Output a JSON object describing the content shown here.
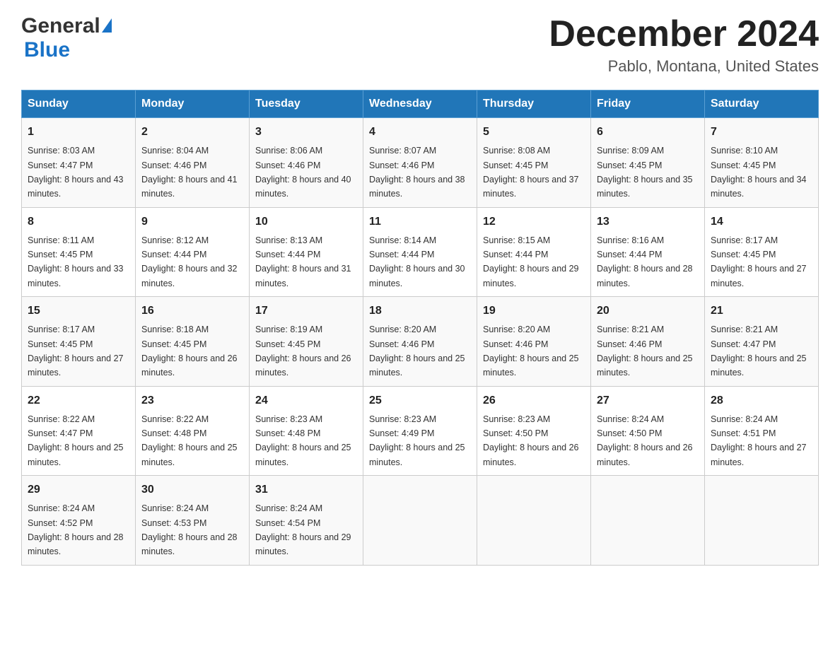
{
  "header": {
    "logo_line1": "General",
    "logo_line2": "Blue",
    "title": "December 2024",
    "subtitle": "Pablo, Montana, United States"
  },
  "calendar": {
    "days_of_week": [
      "Sunday",
      "Monday",
      "Tuesday",
      "Wednesday",
      "Thursday",
      "Friday",
      "Saturday"
    ],
    "weeks": [
      [
        {
          "day": "1",
          "sunrise": "8:03 AM",
          "sunset": "4:47 PM",
          "daylight": "8 hours and 43 minutes."
        },
        {
          "day": "2",
          "sunrise": "8:04 AM",
          "sunset": "4:46 PM",
          "daylight": "8 hours and 41 minutes."
        },
        {
          "day": "3",
          "sunrise": "8:06 AM",
          "sunset": "4:46 PM",
          "daylight": "8 hours and 40 minutes."
        },
        {
          "day": "4",
          "sunrise": "8:07 AM",
          "sunset": "4:46 PM",
          "daylight": "8 hours and 38 minutes."
        },
        {
          "day": "5",
          "sunrise": "8:08 AM",
          "sunset": "4:45 PM",
          "daylight": "8 hours and 37 minutes."
        },
        {
          "day": "6",
          "sunrise": "8:09 AM",
          "sunset": "4:45 PM",
          "daylight": "8 hours and 35 minutes."
        },
        {
          "day": "7",
          "sunrise": "8:10 AM",
          "sunset": "4:45 PM",
          "daylight": "8 hours and 34 minutes."
        }
      ],
      [
        {
          "day": "8",
          "sunrise": "8:11 AM",
          "sunset": "4:45 PM",
          "daylight": "8 hours and 33 minutes."
        },
        {
          "day": "9",
          "sunrise": "8:12 AM",
          "sunset": "4:44 PM",
          "daylight": "8 hours and 32 minutes."
        },
        {
          "day": "10",
          "sunrise": "8:13 AM",
          "sunset": "4:44 PM",
          "daylight": "8 hours and 31 minutes."
        },
        {
          "day": "11",
          "sunrise": "8:14 AM",
          "sunset": "4:44 PM",
          "daylight": "8 hours and 30 minutes."
        },
        {
          "day": "12",
          "sunrise": "8:15 AM",
          "sunset": "4:44 PM",
          "daylight": "8 hours and 29 minutes."
        },
        {
          "day": "13",
          "sunrise": "8:16 AM",
          "sunset": "4:44 PM",
          "daylight": "8 hours and 28 minutes."
        },
        {
          "day": "14",
          "sunrise": "8:17 AM",
          "sunset": "4:45 PM",
          "daylight": "8 hours and 27 minutes."
        }
      ],
      [
        {
          "day": "15",
          "sunrise": "8:17 AM",
          "sunset": "4:45 PM",
          "daylight": "8 hours and 27 minutes."
        },
        {
          "day": "16",
          "sunrise": "8:18 AM",
          "sunset": "4:45 PM",
          "daylight": "8 hours and 26 minutes."
        },
        {
          "day": "17",
          "sunrise": "8:19 AM",
          "sunset": "4:45 PM",
          "daylight": "8 hours and 26 minutes."
        },
        {
          "day": "18",
          "sunrise": "8:20 AM",
          "sunset": "4:46 PM",
          "daylight": "8 hours and 25 minutes."
        },
        {
          "day": "19",
          "sunrise": "8:20 AM",
          "sunset": "4:46 PM",
          "daylight": "8 hours and 25 minutes."
        },
        {
          "day": "20",
          "sunrise": "8:21 AM",
          "sunset": "4:46 PM",
          "daylight": "8 hours and 25 minutes."
        },
        {
          "day": "21",
          "sunrise": "8:21 AM",
          "sunset": "4:47 PM",
          "daylight": "8 hours and 25 minutes."
        }
      ],
      [
        {
          "day": "22",
          "sunrise": "8:22 AM",
          "sunset": "4:47 PM",
          "daylight": "8 hours and 25 minutes."
        },
        {
          "day": "23",
          "sunrise": "8:22 AM",
          "sunset": "4:48 PM",
          "daylight": "8 hours and 25 minutes."
        },
        {
          "day": "24",
          "sunrise": "8:23 AM",
          "sunset": "4:48 PM",
          "daylight": "8 hours and 25 minutes."
        },
        {
          "day": "25",
          "sunrise": "8:23 AM",
          "sunset": "4:49 PM",
          "daylight": "8 hours and 25 minutes."
        },
        {
          "day": "26",
          "sunrise": "8:23 AM",
          "sunset": "4:50 PM",
          "daylight": "8 hours and 26 minutes."
        },
        {
          "day": "27",
          "sunrise": "8:24 AM",
          "sunset": "4:50 PM",
          "daylight": "8 hours and 26 minutes."
        },
        {
          "day": "28",
          "sunrise": "8:24 AM",
          "sunset": "4:51 PM",
          "daylight": "8 hours and 27 minutes."
        }
      ],
      [
        {
          "day": "29",
          "sunrise": "8:24 AM",
          "sunset": "4:52 PM",
          "daylight": "8 hours and 28 minutes."
        },
        {
          "day": "30",
          "sunrise": "8:24 AM",
          "sunset": "4:53 PM",
          "daylight": "8 hours and 28 minutes."
        },
        {
          "day": "31",
          "sunrise": "8:24 AM",
          "sunset": "4:54 PM",
          "daylight": "8 hours and 29 minutes."
        },
        null,
        null,
        null,
        null
      ]
    ]
  }
}
